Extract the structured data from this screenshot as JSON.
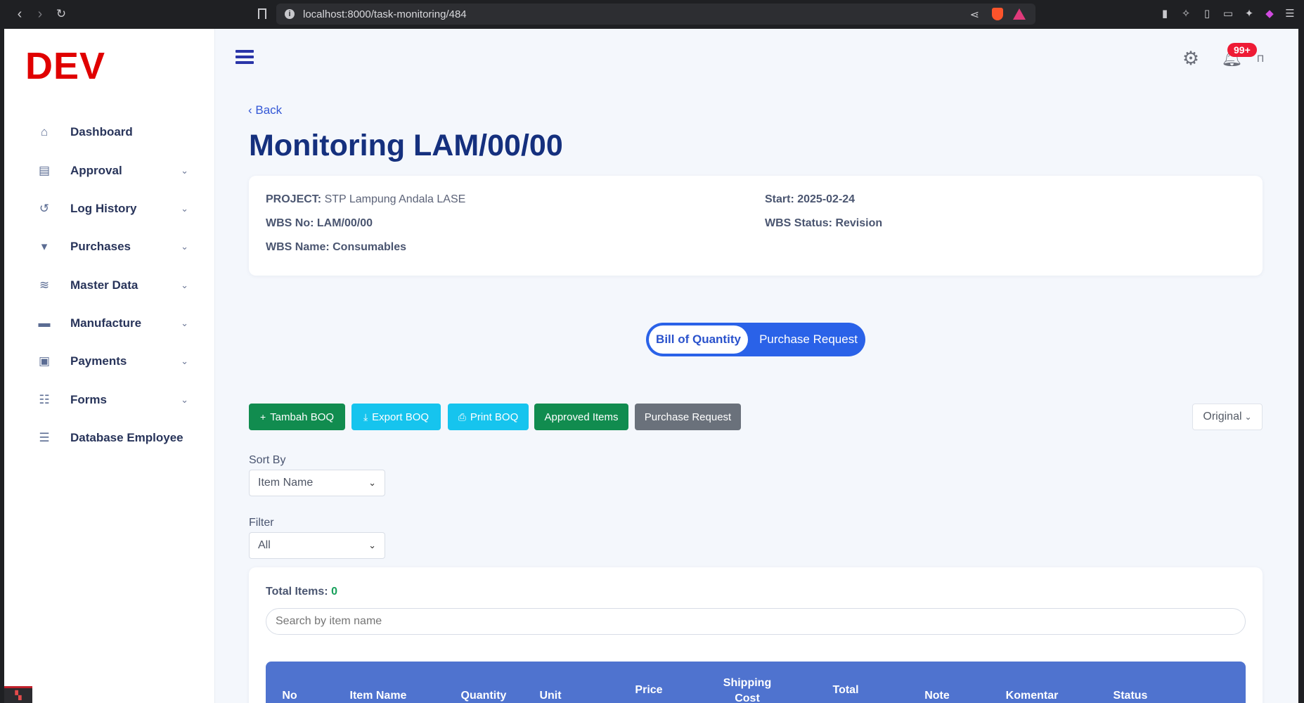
{
  "browser": {
    "url": "localhost:8000/task-monitoring/484"
  },
  "sidebar": {
    "logo": "DEV",
    "items": [
      {
        "label": "Dashboard",
        "icon": "home-icon",
        "has_submenu": false
      },
      {
        "label": "Approval",
        "icon": "approval-icon",
        "has_submenu": true
      },
      {
        "label": "Log History",
        "icon": "history-icon",
        "has_submenu": true
      },
      {
        "label": "Purchases",
        "icon": "cart-icon",
        "has_submenu": true
      },
      {
        "label": "Master Data",
        "icon": "database-icon",
        "has_submenu": true
      },
      {
        "label": "Manufacture",
        "icon": "store-icon",
        "has_submenu": true
      },
      {
        "label": "Payments",
        "icon": "money-icon",
        "has_submenu": true
      },
      {
        "label": "Forms",
        "icon": "list-icon",
        "has_submenu": true
      },
      {
        "label": "Database Employee",
        "icon": "server-icon",
        "has_submenu": false
      }
    ]
  },
  "header": {
    "notification_count": "99+"
  },
  "page": {
    "back_label": "Back",
    "title": "Monitoring LAM/00/00",
    "project_label": "PROJECT:",
    "project_value": "STP Lampung Andala LASE",
    "wbs_no": "WBS No: LAM/00/00",
    "wbs_name": "WBS Name: Consumables",
    "start": "Start: 2025-02-24",
    "wbs_status": "WBS Status: Revision"
  },
  "toggle": {
    "active": "Bill of Quantity",
    "other": "Purchase Request"
  },
  "actions": {
    "tambah": "Tambah BOQ",
    "export": "Export BOQ",
    "print": "Print BOQ",
    "approved": "Approved Items",
    "purchase_request": "Purchase Request",
    "version": "Original"
  },
  "sort": {
    "label": "Sort By",
    "value": "Item Name"
  },
  "filter": {
    "label": "Filter",
    "value": "All"
  },
  "items": {
    "total_label": "Total Items:",
    "total_value": "0",
    "search_placeholder": "Search by item name",
    "columns": [
      "No",
      "Item Name",
      "Quantity",
      "Unit",
      "Price",
      "Shipping Cost",
      "Total",
      "Note",
      "Komentar",
      "Status"
    ]
  },
  "colors": {
    "primary": "#2a62e8",
    "title": "#15307e",
    "success": "#118c4f",
    "info": "#16c4ee",
    "secondary": "#6a717b",
    "table_header": "#4f73cf",
    "badge": "#ee1b35",
    "logo": "#e00000"
  }
}
